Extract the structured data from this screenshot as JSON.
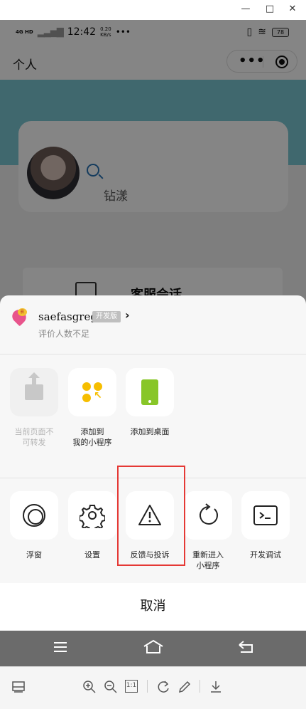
{
  "window": {
    "minimize": "—",
    "maximize": "□",
    "close": "✕"
  },
  "status_bar": {
    "signal": "4G HD",
    "time": "12:42",
    "speed": "0.20\nKB/s",
    "more": "•••",
    "battery": "78"
  },
  "nav": {
    "title": "个人"
  },
  "profile": {
    "name": "钻漾"
  },
  "service": {
    "label": "客服会话"
  },
  "sheet": {
    "app_name": "saefasgrege",
    "badge": "开发版",
    "rating": "评价人数不足",
    "row1": [
      {
        "label": "当前页面不\n可转发",
        "icon": "share-icon",
        "disabled": true
      },
      {
        "label": "添加到\n我的小程序",
        "icon": "add-mini-program-icon"
      },
      {
        "label": "添加到桌面",
        "icon": "add-desktop-icon"
      }
    ],
    "row2": [
      {
        "label": "浮窗",
        "icon": "float-window-icon"
      },
      {
        "label": "设置",
        "icon": "gear-icon"
      },
      {
        "label": "反馈与投诉",
        "icon": "warning-icon"
      },
      {
        "label": "重新进入\n小程序",
        "icon": "refresh-icon"
      },
      {
        "label": "开发调试",
        "icon": "terminal-icon"
      }
    ],
    "cancel": "取消"
  },
  "toolbar": {
    "zoom_ratio": "1:1"
  },
  "colors": {
    "accent_yellow": "#f6be00",
    "accent_green": "#88c628",
    "highlight_red": "#e53935",
    "teal": "#7cc8d4"
  }
}
